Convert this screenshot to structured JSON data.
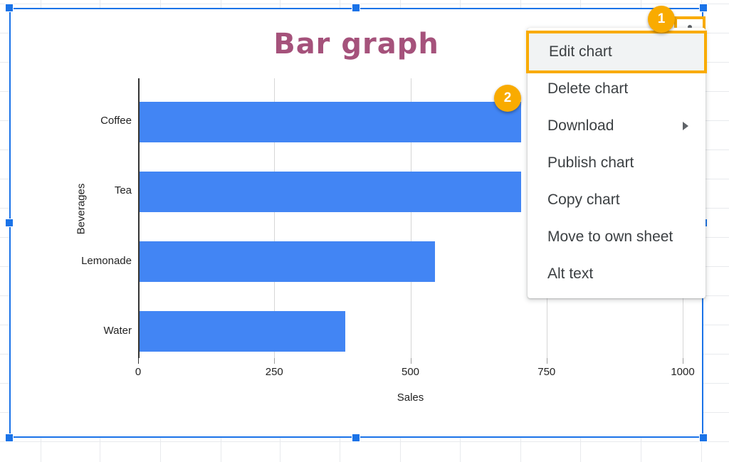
{
  "app": {
    "context": "google-sheets-embedded-chart"
  },
  "chart_data": {
    "type": "bar",
    "orientation": "horizontal",
    "title": "Bar graph",
    "xlabel": "Sales",
    "ylabel": "Beverages",
    "categories": [
      "Coffee",
      "Tea",
      "Lemonade",
      "Water"
    ],
    "values": [
      700,
      700,
      542,
      378
    ],
    "series": [
      {
        "name": "Sales",
        "values": [
          700,
          700,
          542,
          378
        ]
      }
    ],
    "xticks": [
      "0",
      "250",
      "500",
      "750",
      "1000"
    ],
    "xtick_values": [
      0,
      250,
      500,
      750,
      1000
    ],
    "xlim": [
      0,
      1000
    ],
    "grid": true,
    "legend": "none",
    "bar_color": "#4285f4",
    "title_color": "#a5527b",
    "note": "Coffee and Tea bars are partially occluded by the open context menu"
  },
  "kebab_button": {
    "name": "More options",
    "dots": [
      "dot",
      "dot",
      "dot"
    ]
  },
  "menu": {
    "items": [
      {
        "label": "Edit chart",
        "highlighted": true,
        "submenu": false
      },
      {
        "label": "Delete chart",
        "highlighted": false,
        "submenu": false
      },
      {
        "label": "Download",
        "highlighted": false,
        "submenu": true
      },
      {
        "label": "Publish chart",
        "highlighted": false,
        "submenu": false
      },
      {
        "label": "Copy chart",
        "highlighted": false,
        "submenu": false
      },
      {
        "label": "Move to own sheet",
        "highlighted": false,
        "submenu": false
      },
      {
        "label": "Alt text",
        "highlighted": false,
        "submenu": false
      }
    ]
  },
  "annotations": {
    "badge_1": "1",
    "badge_2": "2"
  },
  "colors": {
    "accent_blue": "#1a73e8",
    "bar_blue": "#4285f4",
    "highlight_amber": "#f9ab00",
    "title_mauve": "#a5527b",
    "grid_gray": "#e8eaed"
  }
}
